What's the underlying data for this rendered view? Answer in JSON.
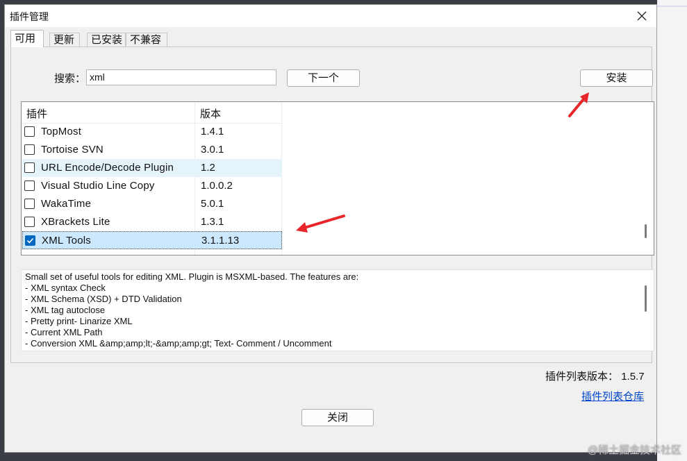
{
  "dialog": {
    "title": "插件管理",
    "close_icon": "close-icon"
  },
  "tabs": [
    {
      "label": "可用",
      "active": true
    },
    {
      "label": "更新",
      "active": false
    },
    {
      "label": "已安装",
      "active": false
    },
    {
      "label": "不兼容",
      "active": false
    }
  ],
  "search": {
    "label": "搜索：",
    "value": "xml"
  },
  "buttons": {
    "next": "下一个",
    "install": "安装",
    "close": "关闭"
  },
  "plugin_list": {
    "columns": [
      "插件",
      "版本"
    ],
    "rows": [
      {
        "name": "TopMost",
        "version": "1.4.1",
        "checked": false
      },
      {
        "name": "Tortoise SVN",
        "version": "3.0.1",
        "checked": false
      },
      {
        "name": "URL Encode/Decode Plugin",
        "version": "1.2",
        "checked": false
      },
      {
        "name": "Visual Studio Line Copy",
        "version": "1.0.0.2",
        "checked": false
      },
      {
        "name": "WakaTime",
        "version": "5.0.1",
        "checked": false
      },
      {
        "name": "XBrackets Lite",
        "version": "1.3.1",
        "checked": false
      },
      {
        "name": "XML Tools",
        "version": "3.1.1.13",
        "checked": true
      }
    ]
  },
  "description": [
    "Small set of useful tools for editing XML. Plugin is MSXML-based. The features are:",
    "- XML syntax Check",
    "- XML Schema (XSD) + DTD Validation",
    "- XML tag autoclose",
    "- Pretty print- Linarize XML",
    "- Current XML Path",
    "- Conversion XML &amp;amp;lt;-&amp;amp;gt; Text- Comment / Uncomment"
  ],
  "footer": {
    "list_version_label": "插件列表版本：",
    "list_version": "1.5.7",
    "repo_link": "插件列表仓库"
  },
  "watermark": "@稀土掘金技术社区",
  "colors": {
    "accent": "#0067c0",
    "selected_row": "#cce8ff",
    "hover_row": "#e5f3fb",
    "annotation_arrow": "#e8262a",
    "link": "#0044cc"
  }
}
